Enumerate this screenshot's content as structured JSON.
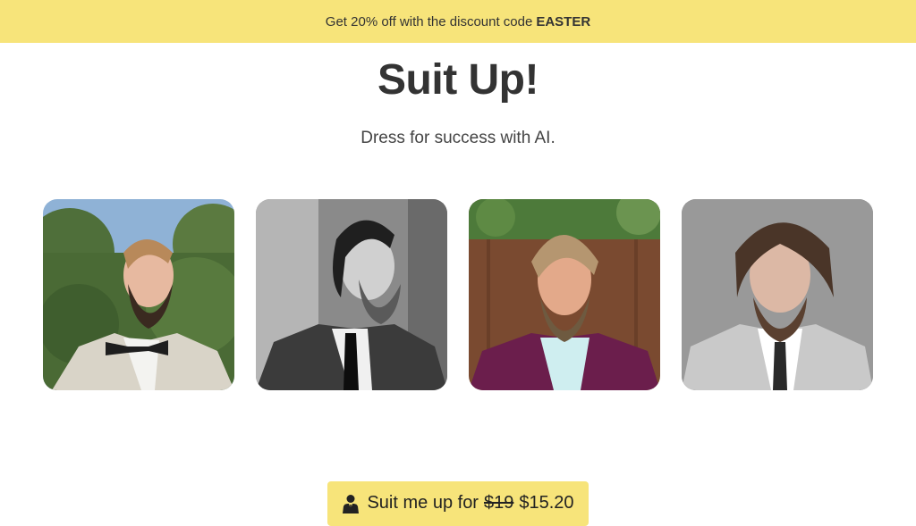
{
  "banner": {
    "text": "Get 20% off with the discount code",
    "code": "EASTER"
  },
  "hero": {
    "title": "Suit Up!",
    "subtitle": "Dress for success with AI."
  },
  "gallery": {
    "photos": [
      {
        "name": "portrait-bowtie-outdoor"
      },
      {
        "name": "portrait-bw-profile"
      },
      {
        "name": "portrait-purple-suit"
      },
      {
        "name": "portrait-grey-suit"
      }
    ]
  },
  "cta": {
    "label": "Suit me up for",
    "old_price": "$19",
    "new_price": "$15.20",
    "icon": "person-suit-icon"
  },
  "colors": {
    "accent": "#f7e47a",
    "text": "#333333"
  }
}
